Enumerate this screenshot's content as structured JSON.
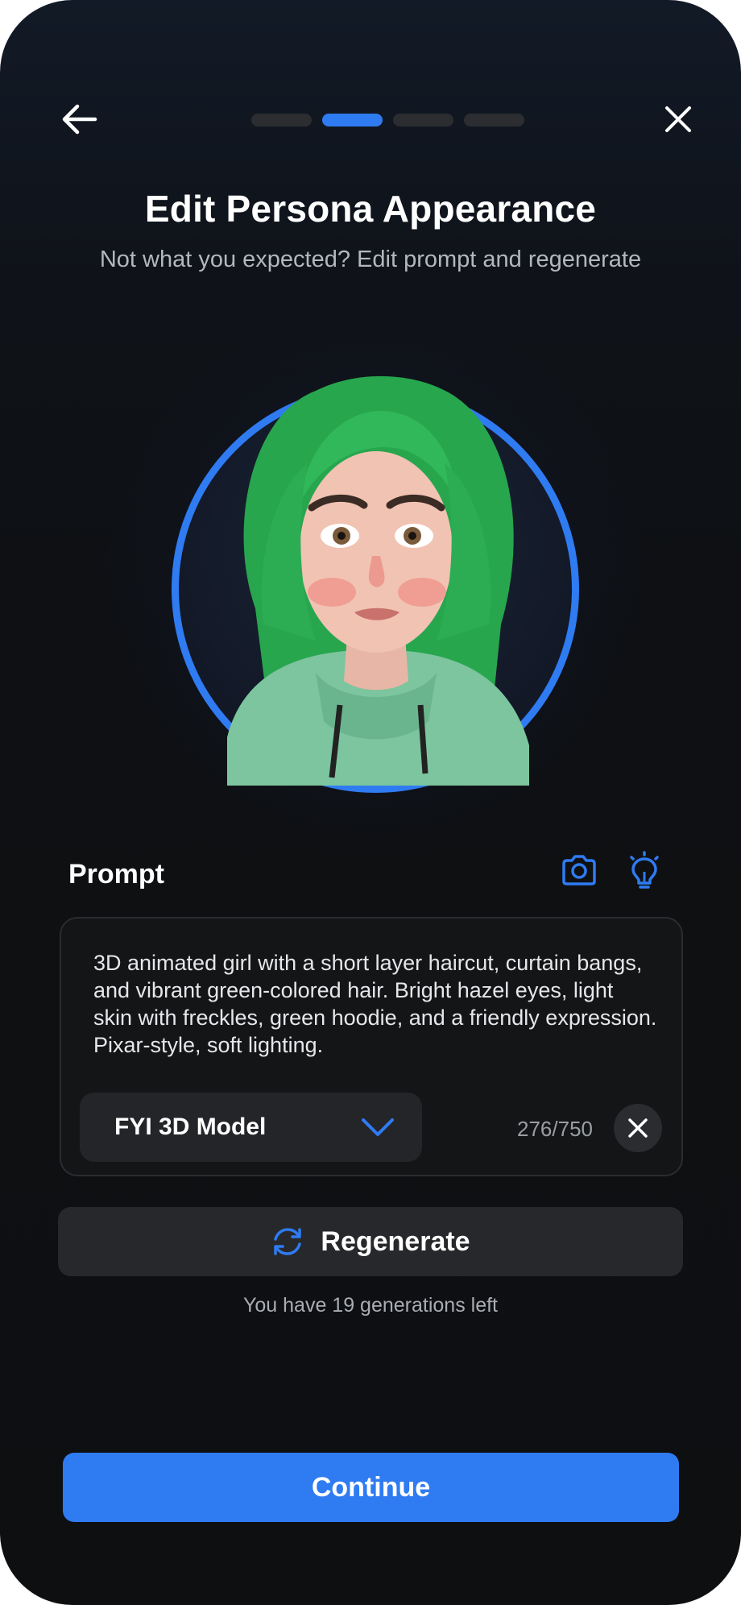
{
  "header": {
    "back_icon": "arrow-left-icon",
    "close_icon": "close-icon",
    "steps_total": 4,
    "current_step": 2
  },
  "title": "Edit Persona Appearance",
  "subtitle": "Not what you expected? Edit prompt and regenerate",
  "avatar": {
    "ring_color": "#2f7bf2",
    "hair_color": "#2fbf5a",
    "hoodie_color": "#7fc7a0"
  },
  "prompt": {
    "label": "Prompt",
    "camera_icon": "camera-icon",
    "idea_icon": "lightbulb-icon",
    "text": "3D animated girl with a short layer haircut, curtain bangs, and vibrant green-colored hair. Bright hazel eyes, light skin with freckles, green hoodie, and a friendly expression. Pixar-style, soft lighting.",
    "model_selected": "FYI 3D Model",
    "char_count": "276/750"
  },
  "regenerate": {
    "label": "Regenerate",
    "icon": "refresh-icon",
    "generations_left": "You have 19 generations left"
  },
  "continue_label": "Continue",
  "colors": {
    "accent": "#2f7bf2",
    "background": "#0e0f11",
    "surface": "#27282b"
  }
}
